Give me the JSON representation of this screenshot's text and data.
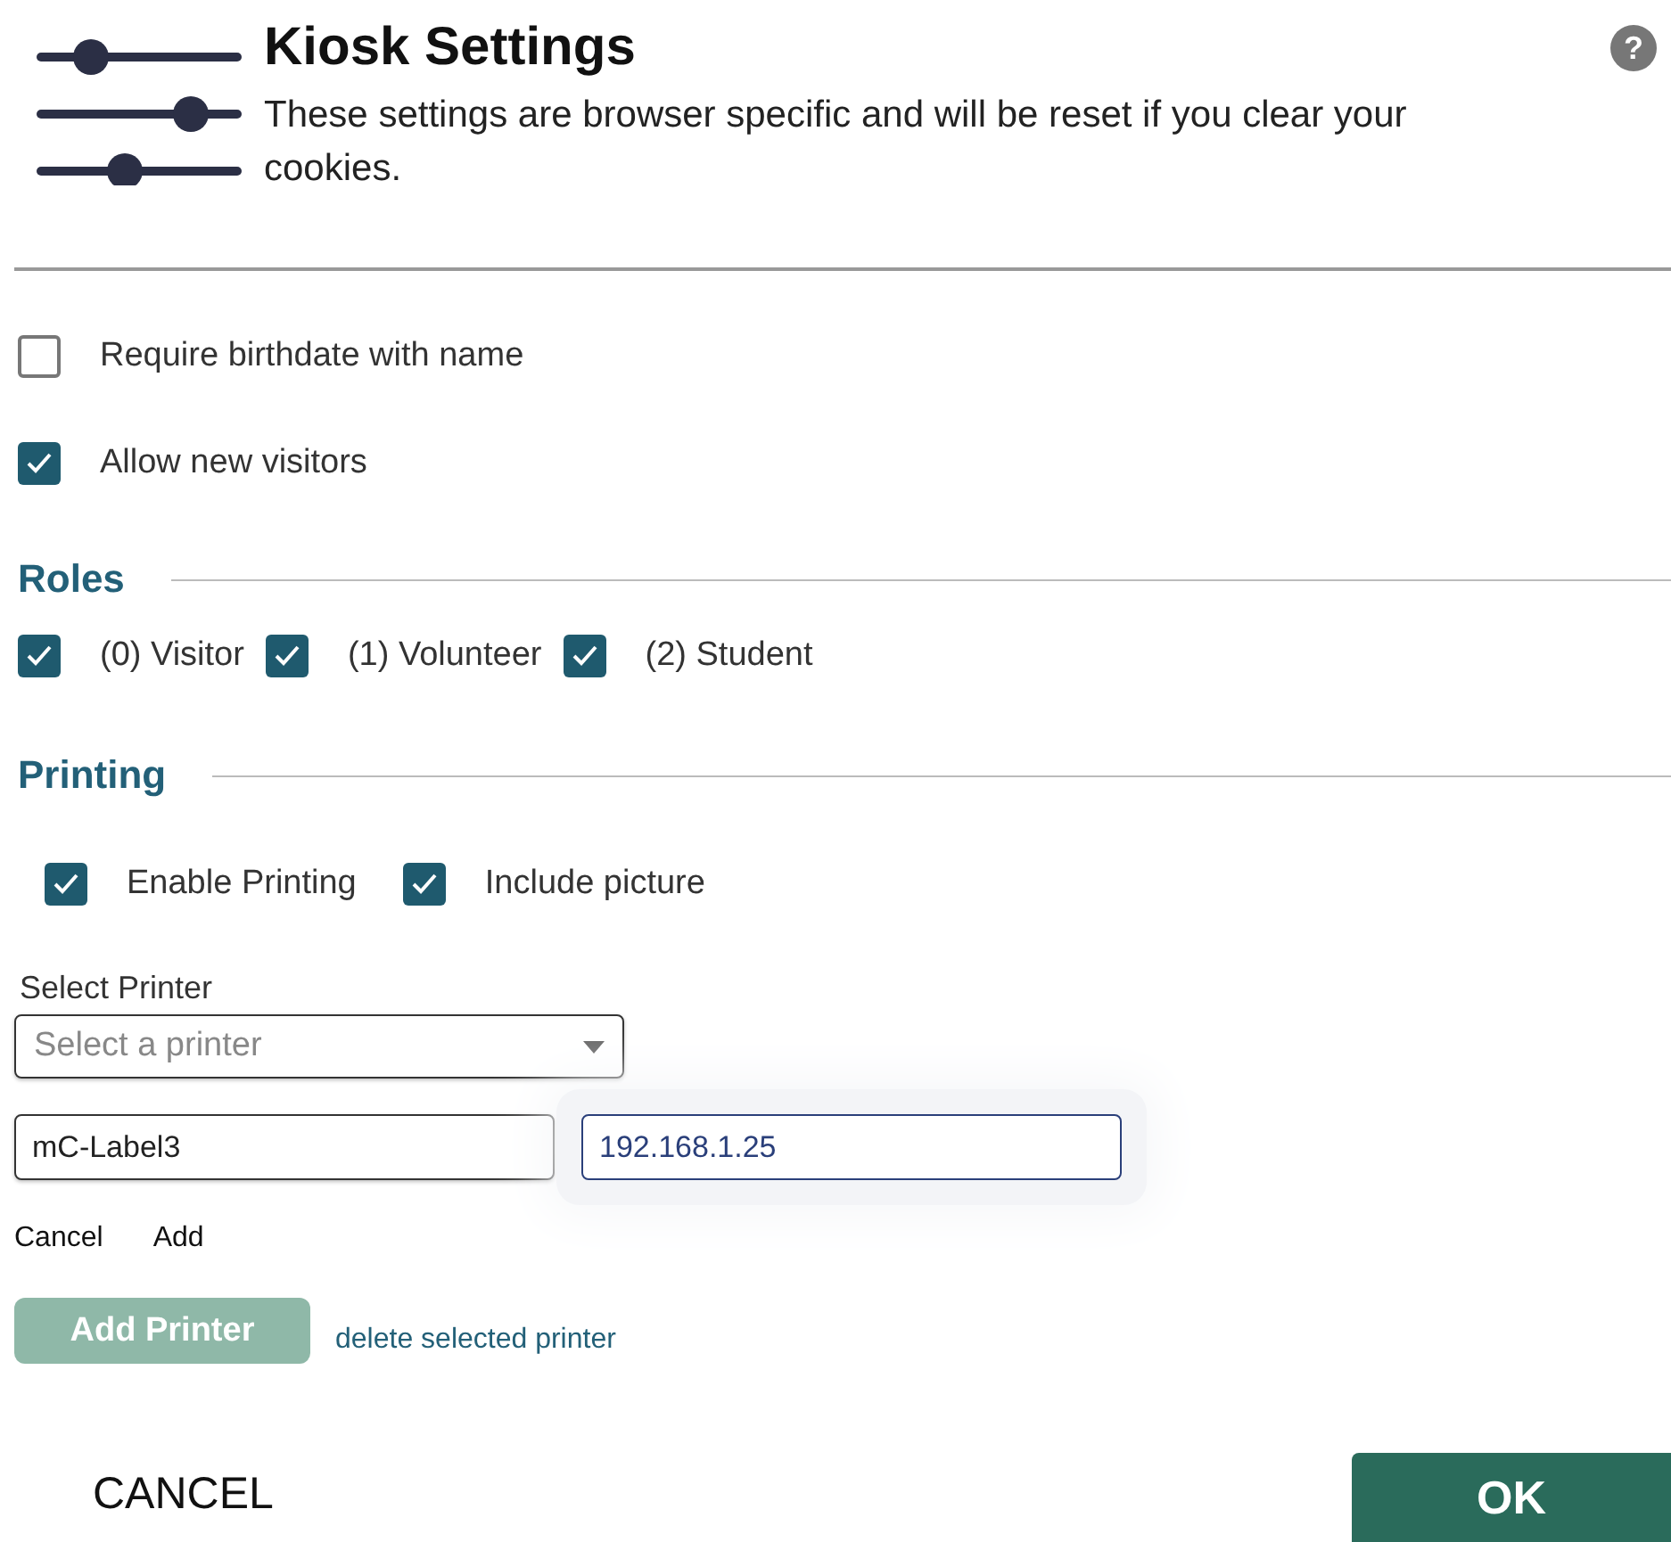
{
  "header": {
    "title": "Kiosk Settings",
    "description": "These settings are browser specific and will be reset if you clear your cookies.",
    "help": "?"
  },
  "options": [
    {
      "label": "Require birthdate with name",
      "checked": false
    },
    {
      "label": "Allow new visitors",
      "checked": true
    }
  ],
  "roles": {
    "heading": "Roles",
    "items": [
      {
        "label": "(0) Visitor",
        "checked": true
      },
      {
        "label": "(1) Volunteer",
        "checked": true
      },
      {
        "label": "(2) Student",
        "checked": true
      }
    ]
  },
  "printing": {
    "heading": "Printing",
    "items": [
      {
        "label": "Enable Printing",
        "checked": true
      },
      {
        "label": "Include picture",
        "checked": true
      }
    ],
    "select_label": "Select Printer",
    "select": {
      "placeholder": "Select a printer"
    },
    "name_field": {
      "value": "mC-Label3"
    },
    "ip_field": {
      "value": "192.168.1.25",
      "focused": true
    },
    "links": [
      "Cancel",
      "Add"
    ],
    "add_button": {
      "label": "Add Printer",
      "disabled": true
    },
    "delete_link": "delete selected printer"
  },
  "footer": {
    "cancel": "CANCEL",
    "ok": "OK"
  }
}
